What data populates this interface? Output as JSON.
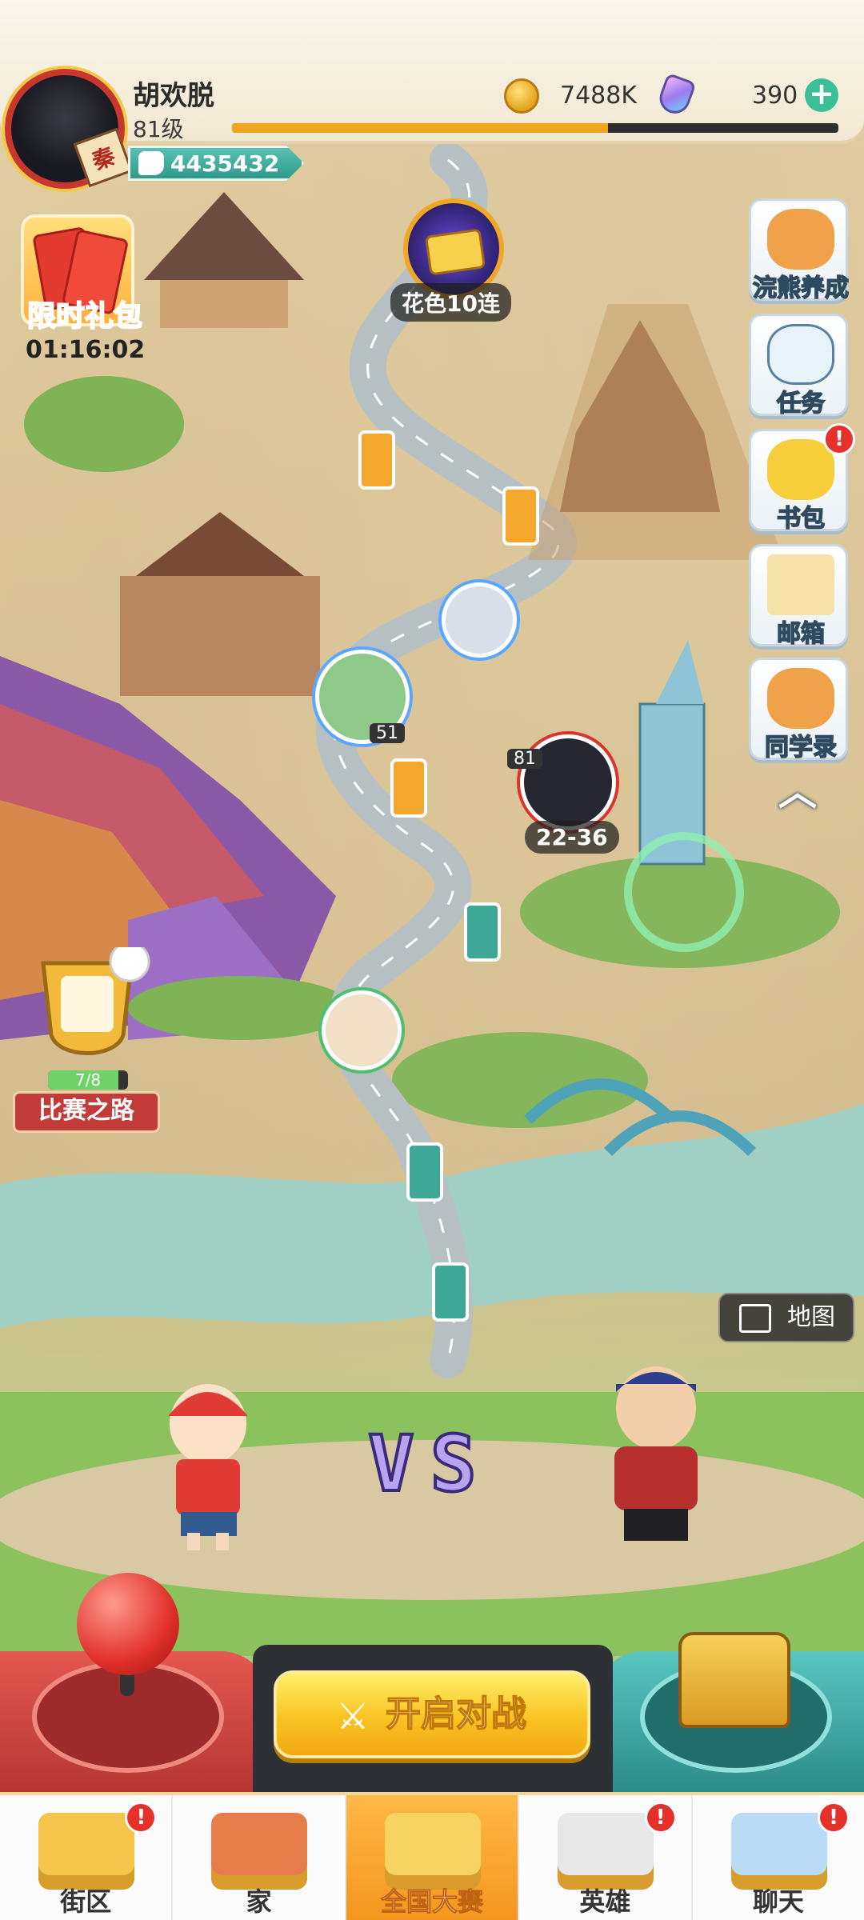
{
  "player": {
    "name": "胡欢脱",
    "level": "81级",
    "power": "4435432",
    "avatar_badge": "秦",
    "xp_progress": 0.62
  },
  "currency": {
    "coins": "7488K",
    "gems": "390"
  },
  "gift_pack": {
    "label": "限时礼包",
    "timer": "01:16:02"
  },
  "side_menu": [
    {
      "label": "浣熊养成",
      "icon": "raccoon-icon",
      "badge": ""
    },
    {
      "label": "任务",
      "icon": "clipboard-icon",
      "badge": ""
    },
    {
      "label": "书包",
      "icon": "backpack-icon",
      "badge": "!"
    },
    {
      "label": "邮箱",
      "icon": "mail-icon",
      "badge": ""
    },
    {
      "label": "同学录",
      "icon": "classmates-icon",
      "badge": ""
    }
  ],
  "map": {
    "ten_draw_label": "花色10连",
    "self_level_tag": "81",
    "self_stage_label": "22-36",
    "race": {
      "label": "比赛之路",
      "progress": "7/8",
      "progress_value": 0.875
    },
    "map_button": "地图",
    "other_player_tag": "51"
  },
  "battle": {
    "vs_text": "VS",
    "start_label": "开启对战"
  },
  "bottom_nav": [
    {
      "label": "街区",
      "icon": "signpost-icon",
      "badge": "!",
      "active": false
    },
    {
      "label": "家",
      "icon": "house-icon",
      "badge": "",
      "active": false
    },
    {
      "label": "全国大赛",
      "icon": "trophy-icon",
      "badge": "",
      "active": true
    },
    {
      "label": "英雄",
      "icon": "hero-cards-icon",
      "badge": "!",
      "active": false
    },
    {
      "label": "聊天",
      "icon": "chat-icon",
      "badge": "!",
      "active": false
    }
  ],
  "colors": {
    "accent": "#f5951e",
    "alert": "#e6302a",
    "power": "#2f9a8a"
  }
}
